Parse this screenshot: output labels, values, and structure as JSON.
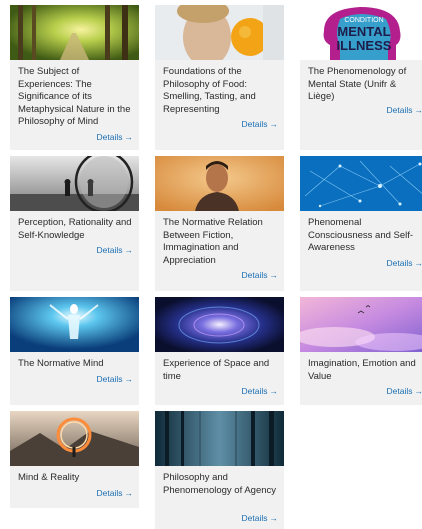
{
  "details_label": "Details",
  "arrow": "→",
  "cards": [
    {
      "title": "The Subject of Experiences: The Significance of its Metaphysical Nature in the Philosophy of Mind",
      "image": "forest-path-sunlight"
    },
    {
      "title": "Foundations of the Philosophy of Food: Smelling, Tasting, and Representing",
      "image": "woman-smelling-orange"
    },
    {
      "title": "The Phenomenology of Mental State (Unifr & Liège)",
      "image": "mental-illness-head-graphic"
    },
    {
      "title": "Perception, Rationality and Self-Knowledge",
      "image": "chess-pieces-mirror"
    },
    {
      "title": "The Normative Relation Between Fiction, Immagination and Appreciation",
      "image": "man-portrait"
    },
    {
      "title": "Phenomenal Consciousness and Self-Awareness",
      "image": "blue-network-mesh"
    },
    {
      "title": "The Normative Mind",
      "image": "glowing-figure-blue"
    },
    {
      "title": "Experience of Space and time",
      "image": "space-vortex"
    },
    {
      "title": "Imagination, Emotion and Value",
      "image": "pink-clouds-birds"
    },
    {
      "title": "Mind & Reality",
      "image": "light-portal-person"
    },
    {
      "title": "Philosophy and Phenomenology of Agency",
      "image": "misty-forest"
    }
  ],
  "mental_illness_text": [
    "CONDITION",
    "MENTAL",
    "ILLNESS"
  ]
}
